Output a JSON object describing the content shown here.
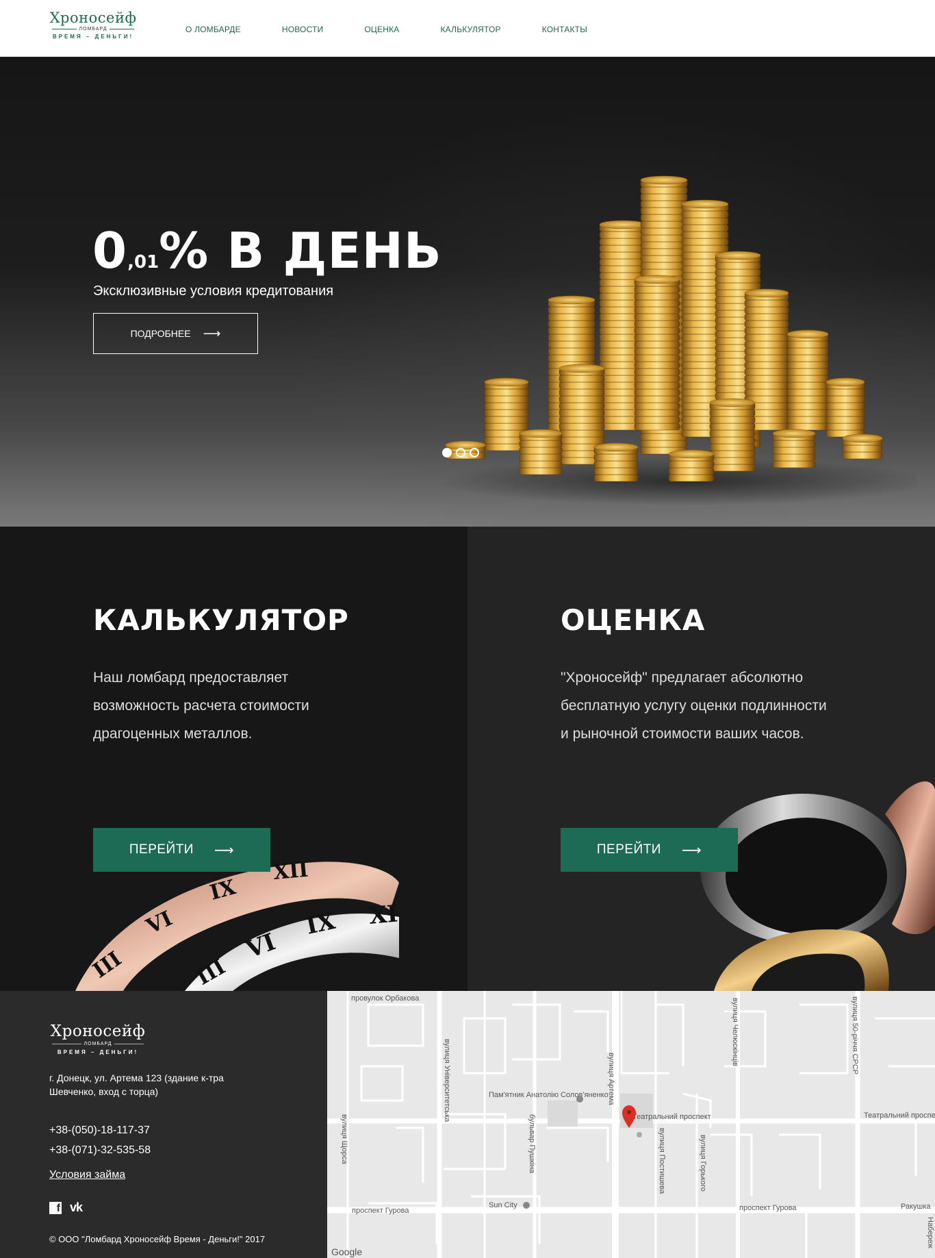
{
  "header": {
    "logo": {
      "name": "Хроносейф",
      "sub": "ЛОМБАРД",
      "motto": "ВРЕМЯ – ДЕНЬГИ!"
    },
    "nav": [
      "О ЛОМБАРДЕ",
      "НОВОСТИ",
      "ОЦЕНКА",
      "КАЛЬКУЛЯТОР",
      "КОНТАКТЫ"
    ]
  },
  "hero": {
    "title_big": "0",
    "title_small": ",01",
    "title_rest": "% В ДЕНЬ",
    "subtitle": "Эксклюзивные условия кредитования",
    "button_label": "ПОДРОБНЕЕ",
    "slides": 3,
    "active_slide": 1
  },
  "features": {
    "calculator": {
      "title": "КАЛЬКУЛЯТОР",
      "text": "Наш ломбард предоставляет возможность расчета стоимости драгоценных металлов.",
      "button_label": "ПЕРЕЙТИ"
    },
    "appraisal": {
      "title": "ОЦЕНКА",
      "text": "\"Хроносейф\" предлагает абсолютно бесплатную услугу оценки подлинности и рыночной стоимости ваших часов.",
      "button_label": "ПЕРЕЙТИ"
    }
  },
  "footer": {
    "logo": {
      "name": "Хроносейф",
      "sub": "ЛОМБАРД",
      "motto": "ВРЕМЯ – ДЕНЬГИ!"
    },
    "address": "г. Донецк, ул. Артема 123 (здание к-тра Шевченко, вход с торца)",
    "phones": [
      "+38-(050)-18-117-37",
      "+38-(071)-32-535-58"
    ],
    "terms_link": "Условия займа",
    "social_icons": [
      "facebook-icon",
      "vk-icon"
    ],
    "copyright": "© ООО \"Ломбард Хроносейф Время - Деньги!\" 2017"
  },
  "map": {
    "labels": {
      "pereulok": "провулок Орбакова",
      "universitetskaya": "вулиця Університетська",
      "shchorsa": "вулиця Щорса",
      "pamyatnik": "Пам'ятник Анатолію Солов'яненко",
      "artema": "вулиця Артема",
      "teatralny": "Театральний проспект",
      "teatralny_right": "Театральний проспект",
      "chelyuskintsev": "вулиця Челюскінців",
      "sssr": "вулиця 50-річчя СРСР",
      "pushkina": "бульвар Пушкіна",
      "postysheva": "вулиця Постишева",
      "gorkogo": "вулиця Горького",
      "gurova_left": "проспект Гурова",
      "gurova_right": "проспект Гурова",
      "sun_city": "Sun City",
      "rakushka": "Ракушка",
      "naberezhnaya": "Набереж",
      "google": "Google"
    },
    "colors": {
      "background": "#e8e8e8",
      "road": "#ffffff",
      "marker": "#d93025"
    }
  }
}
